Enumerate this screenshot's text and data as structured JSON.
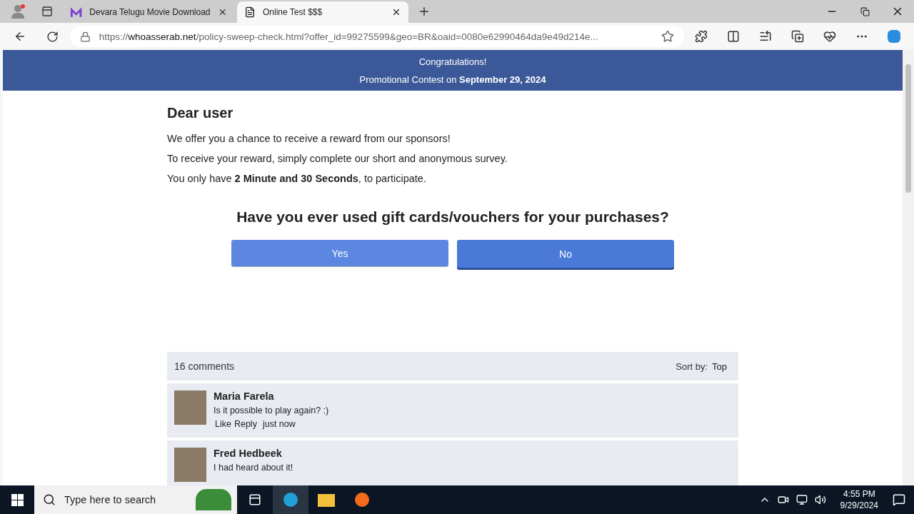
{
  "browser": {
    "tabs": [
      {
        "title": "Devara Telugu Movie Download",
        "selected": false
      },
      {
        "title": "Online Test $$$",
        "selected": true
      }
    ],
    "address": {
      "scheme": "https://",
      "host": "whoasserab.net",
      "rest": "/policy-sweep-check.html?offer_id=99275599&geo=BR&oaid=0080e62990464da9e49d214e..."
    }
  },
  "banner": {
    "title": "Congratulations!",
    "subtitle": "Promotional Contest on **September 29, 2024**"
  },
  "greeting": "Dear user",
  "paragraphs": [
    "We offer you a chance to receive a reward from our sponsors!",
    "To receive your reward, simply complete our short and anonymous survey.",
    "You only have **2 Minute and 30 Seconds**, to participate."
  ],
  "question": "Have you ever used gift cards/vouchers for your purchases?",
  "answers": [
    {
      "label": "Yes",
      "selected": false
    },
    {
      "label": "No",
      "selected": true
    }
  ],
  "comments": {
    "count": "16 comments",
    "sort_label": "Sort by:",
    "sort_value": "Top",
    "items": [
      {
        "name": "Maria Farela",
        "text": "Is it possible to play again? :)",
        "actions": [
          "Like",
          "Reply"
        ],
        "time": "just now"
      },
      {
        "name": "Fred Hedbeek",
        "text": "I had heard about it!"
      }
    ]
  },
  "taskbar": {
    "search_placeholder": "Type here to search",
    "time": "4:55 PM",
    "date": "9/29/2024"
  }
}
